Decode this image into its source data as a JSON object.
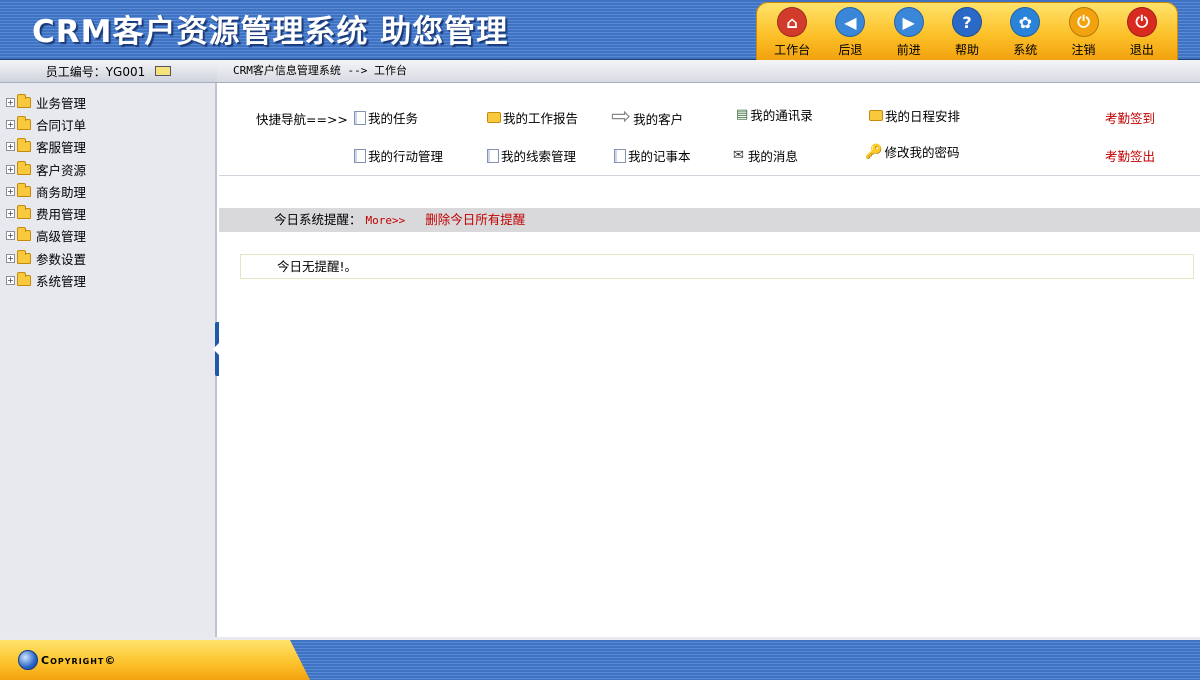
{
  "header": {
    "title": "CRM客户资源管理系统  助您管理",
    "toolbar": [
      {
        "label": "工作台",
        "icon": "home-icon",
        "color": "#d23b2b"
      },
      {
        "label": "后退",
        "icon": "back-arrow-icon",
        "color": "#3a86d8"
      },
      {
        "label": "前进",
        "icon": "forward-arrow-icon",
        "color": "#3a86d8"
      },
      {
        "label": "帮助",
        "icon": "help-icon",
        "color": "#2a69c6"
      },
      {
        "label": "系统",
        "icon": "gear-icon",
        "color": "#2a83d8"
      },
      {
        "label": "注销",
        "icon": "power-icon",
        "color": "#f2a20e"
      },
      {
        "label": "退出",
        "icon": "exit-power-icon",
        "color": "#d82a1f"
      }
    ]
  },
  "user": {
    "employee_id_text": "员工编号：YG001",
    "mail_icon": "mail-icon"
  },
  "breadcrumb": "CRM客户信息管理系统 --> 工作台",
  "sidebar": {
    "items": [
      {
        "label": "业务管理"
      },
      {
        "label": "合同订单"
      },
      {
        "label": "客服管理"
      },
      {
        "label": "客户资源"
      },
      {
        "label": "商务助理"
      },
      {
        "label": "费用管理"
      },
      {
        "label": "高级管理"
      },
      {
        "label": "参数设置"
      },
      {
        "label": "系统管理"
      }
    ]
  },
  "quicknav": {
    "label": "快捷导航==>>",
    "row1": [
      {
        "label": "我的任务",
        "icon": "document-icon"
      },
      {
        "label": "我的工作报告",
        "icon": "folder-icon"
      },
      {
        "label": "我的客户",
        "icon": "arrow-right-icon"
      },
      {
        "label": "我的通讯录",
        "icon": "notepad-icon"
      },
      {
        "label": "我的日程安排",
        "icon": "open-folder-icon"
      }
    ],
    "row2": [
      {
        "label": "我的行动管理",
        "icon": "document-icon"
      },
      {
        "label": "我的线索管理",
        "icon": "document-icon"
      },
      {
        "label": "我的记事本",
        "icon": "document-icon"
      },
      {
        "label": "我的消息",
        "icon": "envelope-icon"
      },
      {
        "label": "修改我的密码",
        "icon": "key-icon"
      }
    ],
    "checkin": "考勤签到",
    "checkout": "考勤签出"
  },
  "reminder": {
    "label": "今日系统提醒：",
    "more": "More>>",
    "clear": "删除今日所有提醒",
    "empty": "今日无提醒!。"
  },
  "footer": {
    "copyright": "Copyright©"
  },
  "colors": {
    "header_blue": "#3e73c4",
    "toolbar_orange": "#fcc12a",
    "red_text": "#c00000",
    "sidebar_bg": "#e7e9ef"
  }
}
